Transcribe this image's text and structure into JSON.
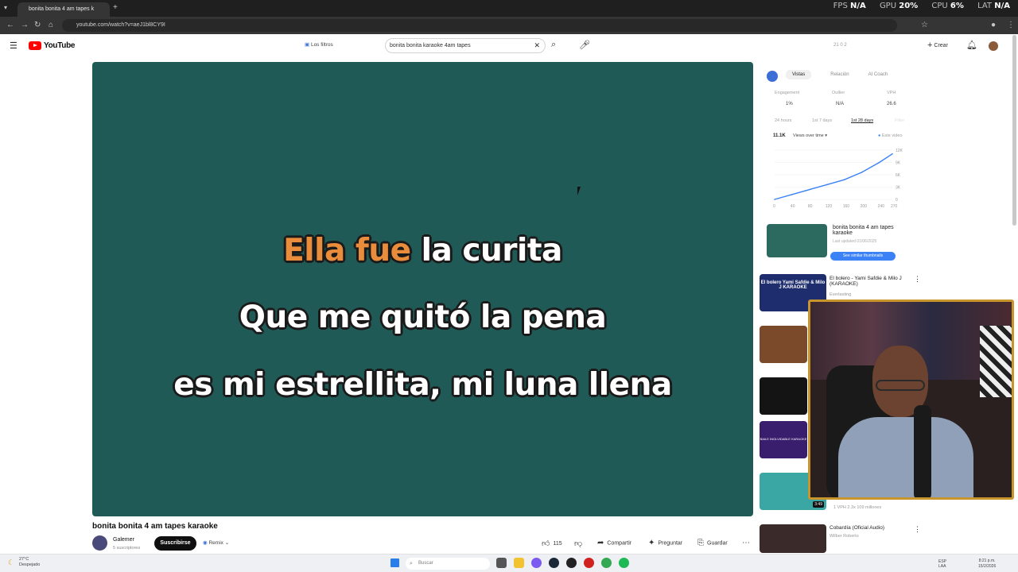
{
  "browser": {
    "tab_title": "bonita bonita 4 am tapes k",
    "url": "youtube.com/watch?v=aeJ1bl8CY9I"
  },
  "overlay_stats": {
    "fps_label": "FPS",
    "fps_value": "N/A",
    "gpu_label": "GPU",
    "gpu_value": "20%",
    "cpu_label": "CPU",
    "cpu_value": "6%",
    "lat_label": "LAT",
    "lat_value": "N/A"
  },
  "header": {
    "logo_text": "YouTube",
    "filters_label": "Los filtros",
    "search_value": "bonita bonita karaoke 4am tapes",
    "counts": "21  0  2",
    "create_label": "Crear"
  },
  "video": {
    "lyrics": [
      {
        "sung": "Ella fue ",
        "unsung": "la curita"
      },
      {
        "sung": "",
        "unsung": "Que me quitó la pena"
      },
      {
        "sung": "",
        "unsung": "es mi estrellita, mi luna llena"
      }
    ],
    "title": "bonita bonita 4 am tapes karaoke",
    "channel": "Galemer",
    "subscribers": "5 suscriptores",
    "subscribe_label": "Suscribirse",
    "remix_label": "Remix",
    "likes": "115",
    "share_label": "Compartir",
    "ask_label": "Preguntar",
    "save_label": "Guardar"
  },
  "analytics_panel": {
    "tabs": [
      "Vistas",
      "Relación",
      "AI Coach"
    ],
    "metrics": [
      {
        "label": "Engagement",
        "value": "1%"
      },
      {
        "label": "Outlier",
        "value": "N/A"
      },
      {
        "label": "VPH",
        "value": "26.6"
      }
    ],
    "ranges": [
      "24 hours",
      "1st 7 days",
      "1st 28 days",
      "Filter"
    ],
    "total_views": "11.1K",
    "views_dropdown": "Views over time",
    "legend_label": "Este video",
    "similar_title": "bonita bonita 4 am tapes karaoke",
    "similar_meta": "Last updated 01/06/2025",
    "similar_button": "See similar thumbnails"
  },
  "chart_data": {
    "type": "line",
    "x": [
      0,
      40,
      80,
      120,
      160,
      200,
      240,
      270
    ],
    "values": [
      0,
      1200,
      2400,
      3600,
      4800,
      6600,
      9000,
      11100
    ],
    "xticks": [
      "0",
      "40",
      "80",
      "120",
      "160",
      "200",
      "240",
      "270"
    ],
    "yticks": [
      "12K",
      "9K",
      "6K",
      "3K",
      "0"
    ],
    "ylim": [
      0,
      12000
    ],
    "color": "#3b82f6"
  },
  "sidebar": {
    "videos": [
      {
        "title": "El bolero - Yami Safdie & Milo J (KARAOKE)",
        "meta": "Everlasting",
        "thumb_text": "El bolero Yami Safdie & Milo J KARAOKE"
      },
      {
        "title": "",
        "meta": ""
      },
      {
        "title": "",
        "meta": ""
      },
      {
        "title": "",
        "meta": "",
        "thumb_text": "BAILE INOLVIDABLE KARAOKE"
      },
      {
        "title": "",
        "meta": "1 VPH  2.3x  109 millones",
        "duration": "3:49"
      },
      {
        "title": "Cobardía (Oficial Audio)",
        "meta": "Wilber Roberto"
      }
    ]
  },
  "taskbar": {
    "weather_temp": "27°C",
    "weather_desc": "Despejado",
    "search_placeholder": "Buscar",
    "lang": "ESP LAA",
    "time": "8:21 p.m.",
    "date": "15/2/2026"
  }
}
